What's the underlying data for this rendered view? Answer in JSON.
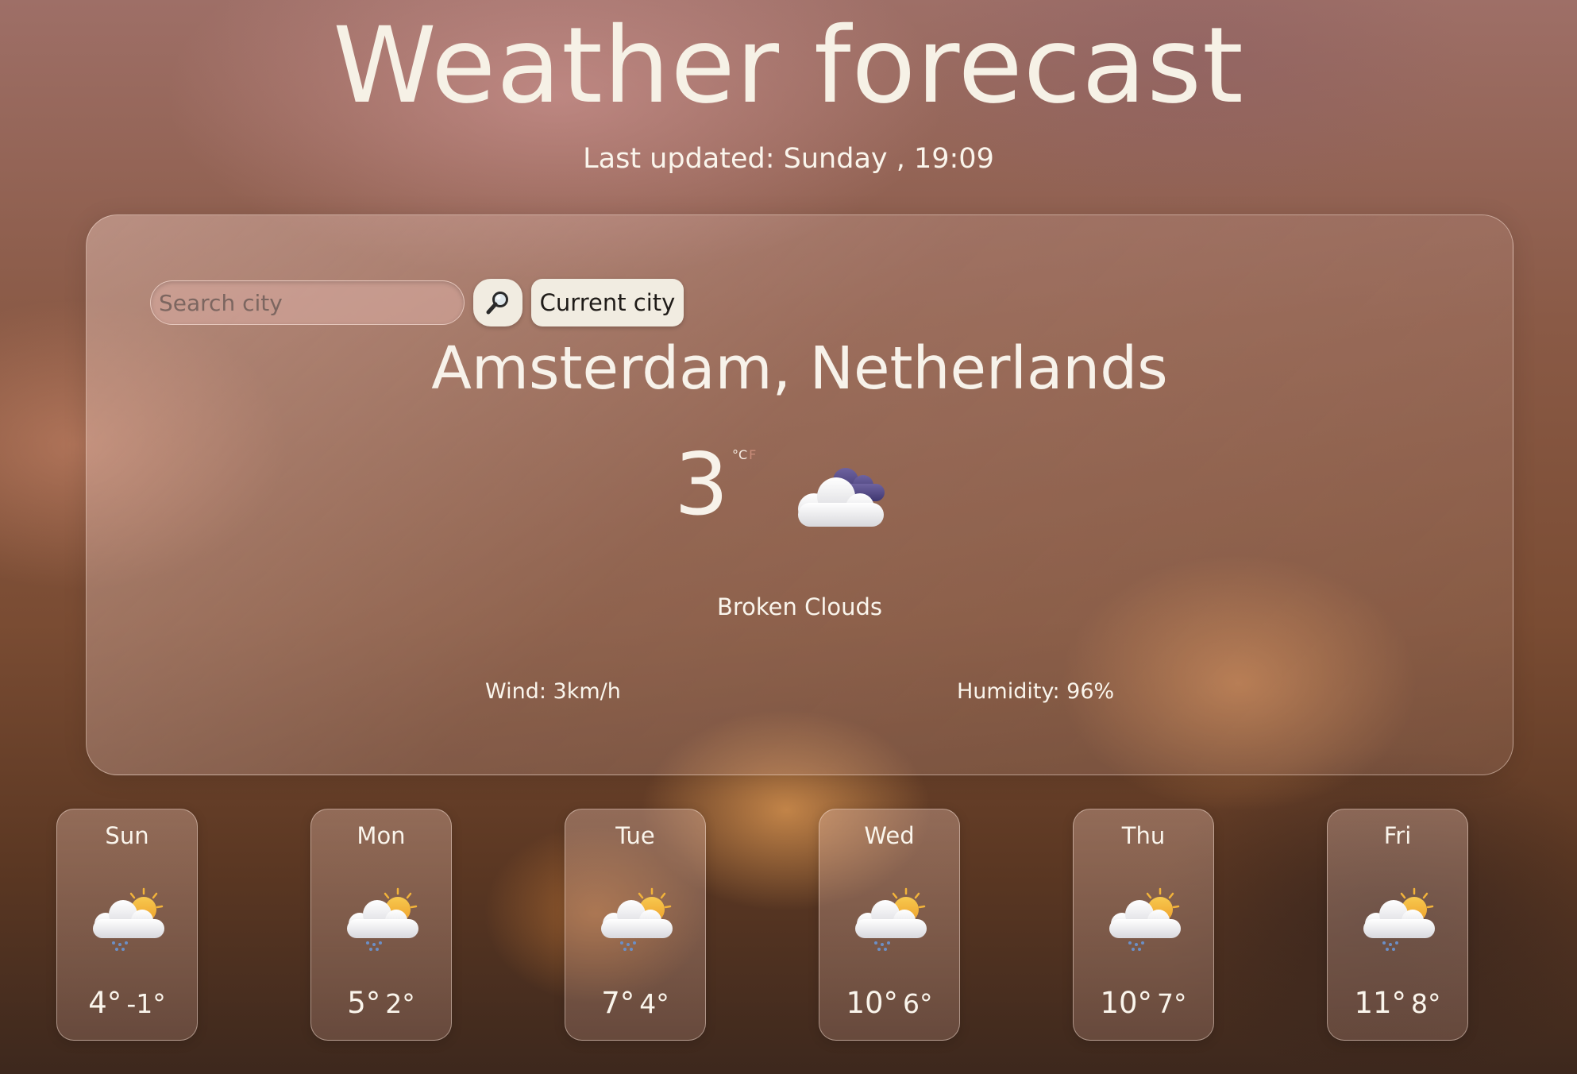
{
  "header": {
    "title": "Weather forecast",
    "last_updated": "Last updated: Sunday , 19:09"
  },
  "search": {
    "placeholder": "Search city",
    "search_icon": "magnifier-icon",
    "current_city_label": "Current city"
  },
  "current": {
    "city": "Amsterdam, Netherlands",
    "temperature": "3",
    "unit_celsius": "°C",
    "unit_fahrenheit": "F",
    "icon": "broken-clouds-icon",
    "description": "Broken Clouds",
    "wind": "Wind: 3km/h",
    "humidity": "Humidity: 96%"
  },
  "forecast": [
    {
      "day": "Sun",
      "high": "4°",
      "low": "-1°",
      "icon": "sun-cloud-rain-icon"
    },
    {
      "day": "Mon",
      "high": "5°",
      "low": "2°",
      "icon": "sun-cloud-rain-icon"
    },
    {
      "day": "Tue",
      "high": "7°",
      "low": "4°",
      "icon": "sun-cloud-rain-icon"
    },
    {
      "day": "Wed",
      "high": "10°",
      "low": "6°",
      "icon": "sun-cloud-rain-icon"
    },
    {
      "day": "Thu",
      "high": "10°",
      "low": "7°",
      "icon": "sun-cloud-rain-icon"
    },
    {
      "day": "Fri",
      "high": "11°",
      "low": "8°",
      "icon": "sun-cloud-rain-icon"
    }
  ],
  "colors": {
    "text": "#f6f1e6",
    "button_bg": "#f1ece1",
    "sun": "#f2b33a",
    "cloud_dark": "#5b5287",
    "rain": "#6b8fc7"
  }
}
